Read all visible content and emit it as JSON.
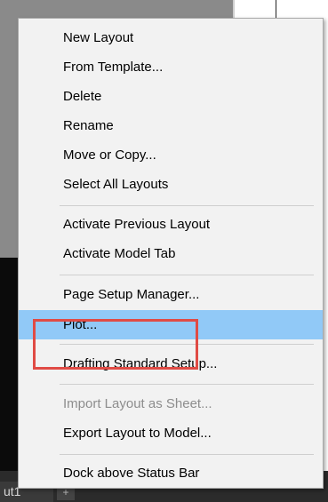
{
  "background": {
    "layout_tab_label": "ut1",
    "add_tab_symbol": "+"
  },
  "menu": {
    "items": [
      {
        "label": "New Layout",
        "state": "enabled"
      },
      {
        "label": "From Template...",
        "state": "enabled"
      },
      {
        "label": "Delete",
        "state": "enabled"
      },
      {
        "label": "Rename",
        "state": "enabled"
      },
      {
        "label": "Move or Copy...",
        "state": "enabled"
      },
      {
        "label": "Select All Layouts",
        "state": "enabled"
      },
      {
        "label": "Activate Previous Layout",
        "state": "enabled"
      },
      {
        "label": "Activate Model Tab",
        "state": "enabled"
      },
      {
        "label": "Page Setup Manager...",
        "state": "enabled"
      },
      {
        "label": "Plot...",
        "state": "highlighted"
      },
      {
        "label": "Drafting Standard Setup...",
        "state": "enabled"
      },
      {
        "label": "Import Layout as Sheet...",
        "state": "disabled"
      },
      {
        "label": "Export Layout to Model...",
        "state": "enabled"
      },
      {
        "label": "Dock above Status Bar",
        "state": "enabled"
      }
    ],
    "highlight_color": "#91c9f7",
    "annotation_color": "#e04b45"
  }
}
